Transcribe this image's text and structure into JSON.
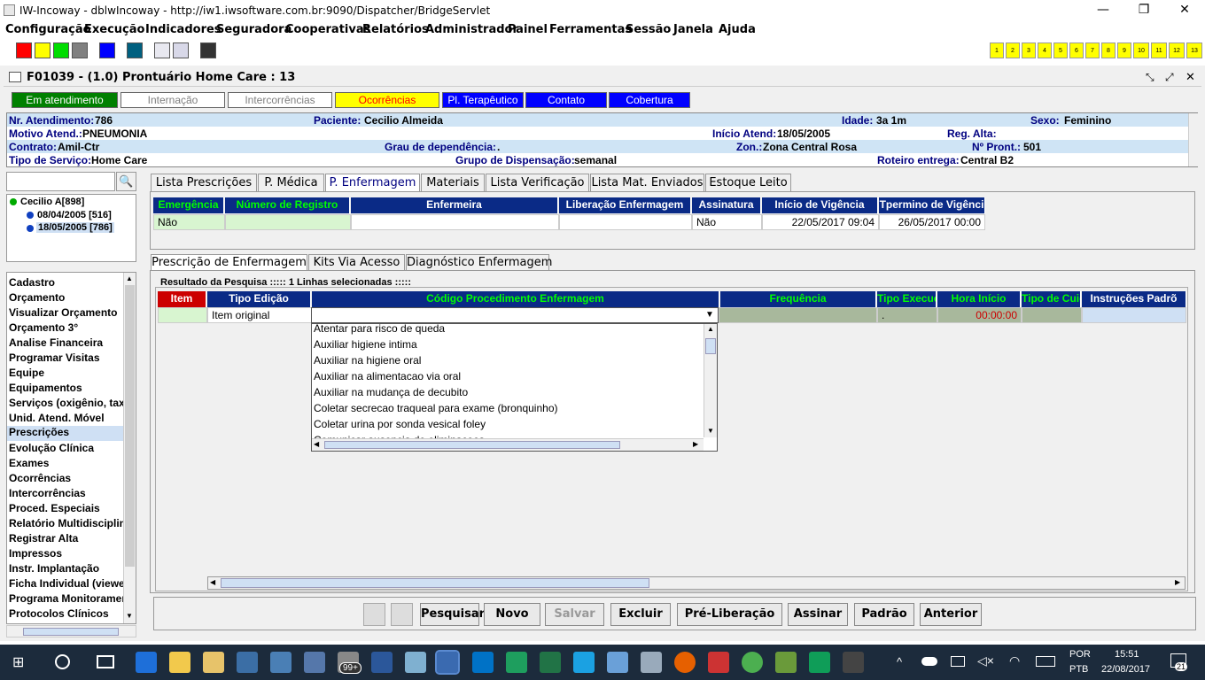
{
  "window": {
    "title": "IW-Incoway - dblwIncoway - http://iw1.iwsoftware.com.br:9090/Dispatcher/BridgeServlet",
    "minimize": "—",
    "maximize": "❐",
    "close": "✕"
  },
  "menu": [
    "Configuração",
    "Execução",
    "Indicadores",
    "Seguradora",
    "Cooperativas",
    "Relatórios",
    "Administrador",
    "Painel",
    "Ferramentas",
    "Sessão",
    "Janela",
    "Ajuda"
  ],
  "toolbar": {
    "swatches": [
      "#ff0000",
      "#ffff00",
      "#00dd00",
      "#808080",
      "#0000ff",
      "#006080"
    ],
    "numbers": [
      "1",
      "2",
      "3",
      "4",
      "5",
      "6",
      "7",
      "8",
      "9",
      "10",
      "11",
      "12",
      "13"
    ]
  },
  "frame": {
    "title": "F01039 - (1.0) Prontuário Home Care : 13"
  },
  "status_tabs": [
    {
      "label": "Em atendimento",
      "bg": "#008000",
      "fg": "#ffffff"
    },
    {
      "label": "Internação",
      "bg": "#ffffff",
      "fg": "#808080"
    },
    {
      "label": "Intercorrências",
      "bg": "#ffffff",
      "fg": "#808080"
    },
    {
      "label": "Ocorrências",
      "bg": "#ffff00",
      "fg": "#ff0000"
    },
    {
      "label": "Pl. Terapêutico",
      "bg": "#0000ff",
      "fg": "#ffffff"
    },
    {
      "label": "Contato",
      "bg": "#0000ff",
      "fg": "#ffffff"
    },
    {
      "label": "Cobertura",
      "bg": "#0000ff",
      "fg": "#ffffff"
    }
  ],
  "info": {
    "nr_atendimento_label": "Nr. Atendimento:",
    "nr_atendimento": "786",
    "paciente_label": "Paciente:",
    "paciente": "Cecilio Almeida",
    "idade_label": "Idade:",
    "idade": "3a 1m",
    "sexo_label": "Sexo:",
    "sexo": "Feminino",
    "motivo_label": "Motivo Atend.:",
    "motivo": "PNEUMONIA",
    "inicio_label": "Início Atend:",
    "inicio": "18/05/2005",
    "regalta_label": "Reg. Alta:",
    "regalta": "",
    "contrato_label": "Contrato:",
    "contrato": "Amil-Ctr",
    "grau_label": "Grau de dependência:",
    "grau": ".",
    "zon_label": "Zon.:",
    "zon": "Zona Central Rosa",
    "pront_label": "Nº Pront.:",
    "pront": "501",
    "tiposerv_label": "Tipo de Serviço:",
    "tiposerv": "Home Care",
    "grupo_label": "Grupo de Dispensação:",
    "grupo": "semanal",
    "roteiro_label": "Roteiro entrega:",
    "roteiro": "Central B2"
  },
  "tree": {
    "root": "Cecilio A[898]",
    "items": [
      "08/04/2005 [516]",
      "18/05/2005 [786]"
    ]
  },
  "nav": [
    "Cadastro",
    "Orçamento",
    "Visualizar Orçamento",
    "Orçamento 3°",
    "Analise Financeira",
    "Programar Visitas",
    "Equipe",
    "Equipamentos",
    "Serviços (oxigênio, taxa",
    "Unid. Atend. Móvel",
    "Prescrições",
    "Evolução Clínica",
    "Exames",
    "Ocorrências",
    "Intercorrências",
    "Proced. Especiais",
    "Relatório Multidisciplina",
    "Registrar Alta",
    "Impressos",
    "Instr. Implantação",
    "Ficha Individual (viewer",
    "Programa Monitoramen",
    "Protocolos Clínicos"
  ],
  "main_tabs": [
    "Lista Prescrições",
    "P. Médica",
    "P. Enfermagem",
    "Materiais",
    "Lista Verificação",
    "Lista Mat. Enviados",
    "Estoque Leito"
  ],
  "grid1": {
    "headers": [
      "Emergência",
      "Número de Registro",
      "Enfermeira",
      "Liberação Enfermagem",
      "Assinatura",
      "Início de Vigência",
      "Tpermino de Vigênci"
    ],
    "row": [
      "Não",
      "",
      "",
      "",
      "Não",
      "22/05/2017 09:04",
      "26/05/2017 00:00"
    ]
  },
  "sub_tabs": [
    "Prescrição de Enfermagem",
    "Kits Via Acesso",
    "Diagnóstico Enfermagem"
  ],
  "result_text": "Resultado da Pesquisa ::::: 1 Linhas selecionadas :::::",
  "grid2": {
    "headers": [
      "Item",
      "Tipo Edição",
      "Código Procedimento Enfermagem",
      "Frequência",
      "Tipo Execuç",
      "Hora Início",
      "Tipo de Cuid",
      "Instruções Padrõ"
    ],
    "row": {
      "item": "",
      "tipo": "Item original",
      "codigo": "",
      "frequencia": "",
      "tipoexec": ".",
      "hora": "00:00:00",
      "tipocuid": "",
      "instr": ""
    }
  },
  "dropdown": [
    "Atentar para risco de queda",
    "Auxiliar higiene intima",
    "Auxiliar na  higiene oral",
    "Auxiliar na alimentacao via oral",
    "Auxiliar na mudança de decubito",
    "Coletar secrecao traqueal para exame (bronquinho)",
    "Coletar urina por sonda vesical foley",
    "Comunicar ausencia de eliminacoes"
  ],
  "buttons": [
    "Pesquisar",
    "Novo",
    "Salvar",
    "Excluir",
    "Pré-Liberação",
    "Assinar",
    "Padrão",
    "Anterior"
  ],
  "taskbar": {
    "lang1": "POR",
    "lang2": "PTB",
    "time": "15:51",
    "date": "22/08/2017",
    "badge": "99+",
    "notif": "21"
  }
}
